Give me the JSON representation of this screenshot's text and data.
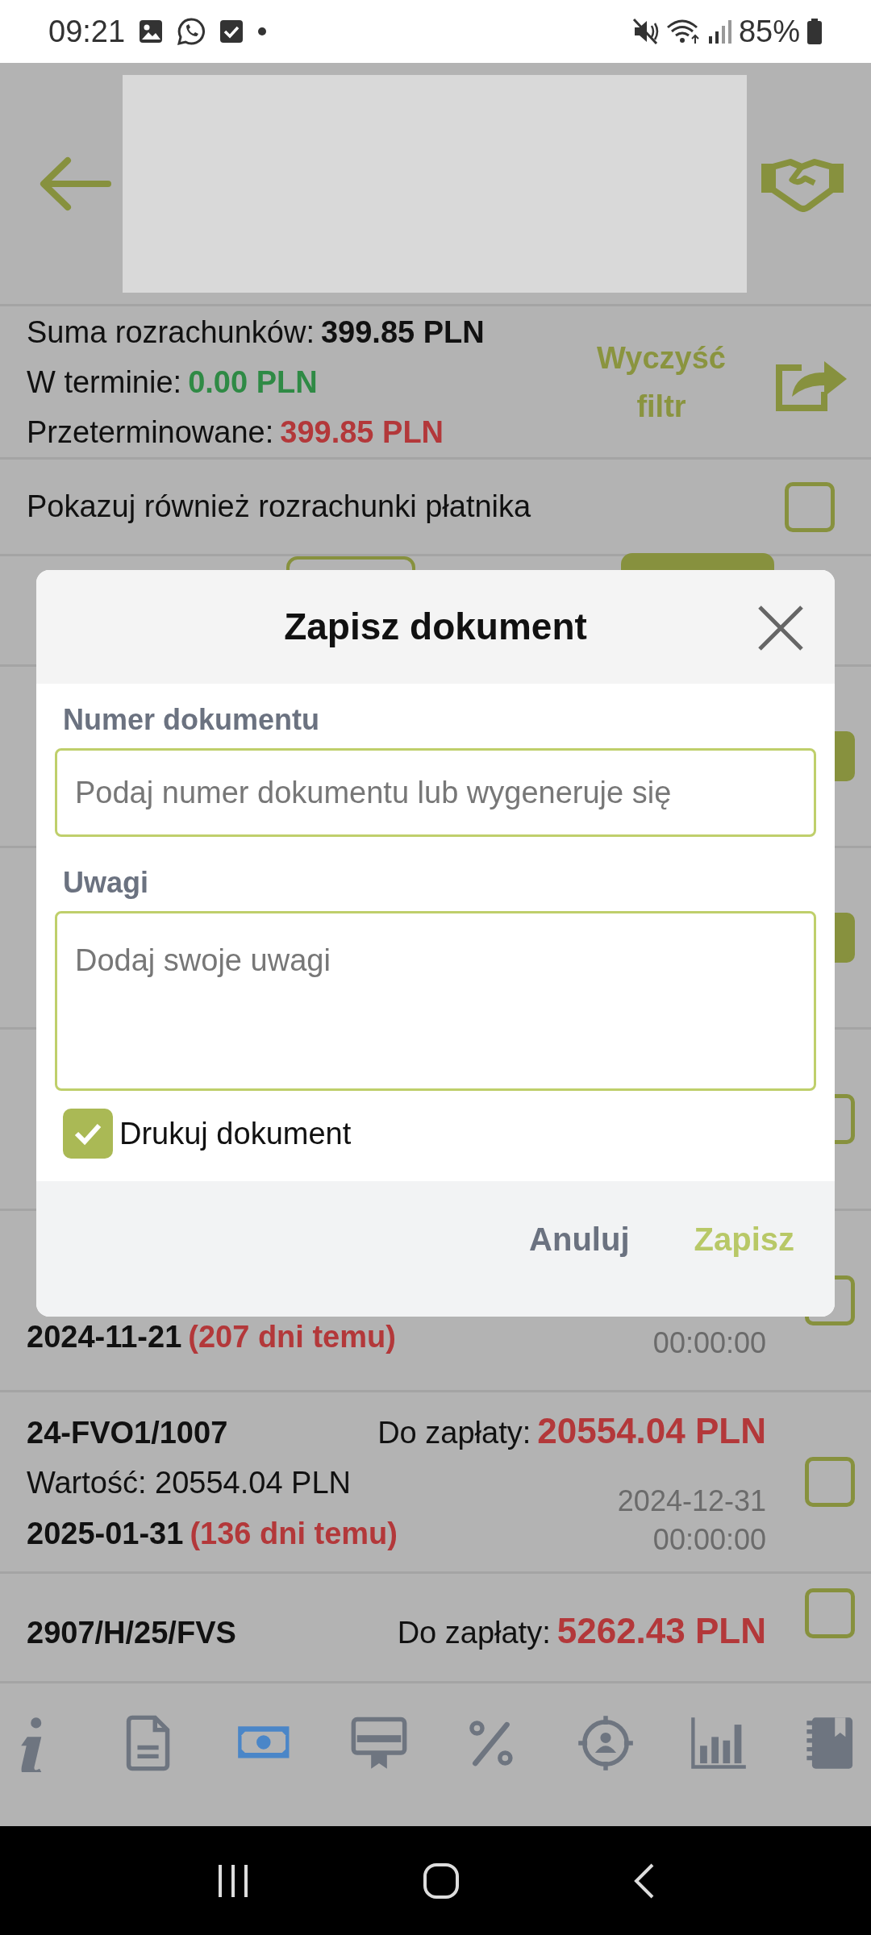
{
  "status_bar": {
    "time": "09:21",
    "battery": "85%"
  },
  "summary": [
    {
      "label": "Suma rozrachunków:",
      "value": "399.85 PLN",
      "color": "#111111"
    },
    {
      "label": "W terminie:",
      "value": "0.00 PLN",
      "color": "#2f8a45"
    },
    {
      "label": "Przeterminowane:",
      "value": "399.85 PLN",
      "color": "#b3383a"
    }
  ],
  "clear_filter": "Wyczyść filtr",
  "payer_toggle": {
    "label": "Pokazuj również rozrachunki płatnika",
    "checked": false
  },
  "rows": [
    {
      "checked": true
    },
    {
      "checked": true
    },
    {
      "checked": false
    },
    {
      "date": "2024-11-21",
      "days": "(207 dni temu)",
      "issue_time": "00:00:00",
      "checked": false
    },
    {
      "number": "24-FVO1/1007",
      "due_label": "Do zapłaty:",
      "due": "20554.04 PLN",
      "value": "Wartość: 20554.04 PLN",
      "date": "2025-01-31",
      "days": "(136 dni temu)",
      "issue_date": "2024-12-31",
      "issue_time": "00:00:00",
      "checked": false
    },
    {
      "number": "2907/H/25/FVS",
      "due_label": "Do zapłaty:",
      "due": "5262.43 PLN",
      "checked": false
    }
  ],
  "bottom_nav": [
    {
      "selected": false
    },
    {
      "selected": false
    },
    {
      "selected": true
    },
    {
      "selected": false
    },
    {
      "selected": false
    },
    {
      "selected": false
    },
    {
      "selected": false
    },
    {
      "selected": false
    }
  ],
  "dialog": {
    "title": "Zapisz dokument",
    "fields": [
      {
        "label": "Numer dokumentu",
        "placeholder": "Podaj numer dokumentu lub wygeneruje się",
        "kind": "input"
      },
      {
        "label": "Uwagi",
        "placeholder": "Dodaj swoje uwagi",
        "kind": "textarea"
      }
    ],
    "print": {
      "label": "Drukuj dokument",
      "checked": true
    },
    "buttons": [
      {
        "label": "Anuluj",
        "kind": "secondary"
      },
      {
        "label": "Zapisz",
        "kind": "primary"
      }
    ]
  }
}
